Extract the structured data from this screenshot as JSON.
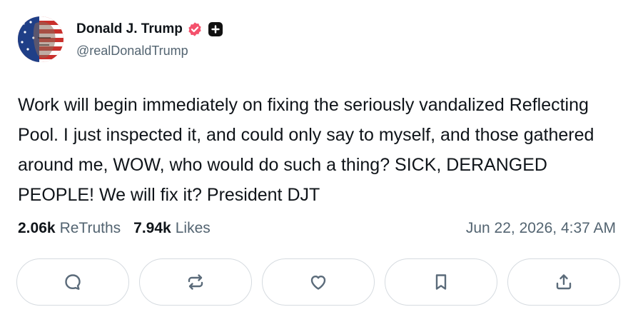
{
  "author": {
    "display_name": "Donald J. Trump",
    "handle": "@realDonaldTrump",
    "verified_color": "#f4516c"
  },
  "post": {
    "text": "Work will begin immediately on fixing the seriously vandalized Reflecting Pool. I just inspected it, and could only say to myself, and those gathered around me, WOW, who would do such a thing? SICK, DERANGED PEOPLE! We will fix it? President DJT"
  },
  "stats": {
    "retruths_value": "2.06k",
    "retruths_label": "ReTruths",
    "likes_value": "7.94k",
    "likes_label": "Likes",
    "timestamp": "Jun 22, 2026, 4:37 AM"
  },
  "actions": [
    {
      "icon": "reply-icon"
    },
    {
      "icon": "retruth-icon"
    },
    {
      "icon": "like-icon"
    },
    {
      "icon": "bookmark-icon"
    },
    {
      "icon": "share-icon"
    }
  ],
  "colors": {
    "text_primary": "#0f1419",
    "text_secondary": "#536471",
    "icon": "#5b6b7a",
    "border": "#d6dbe0"
  }
}
